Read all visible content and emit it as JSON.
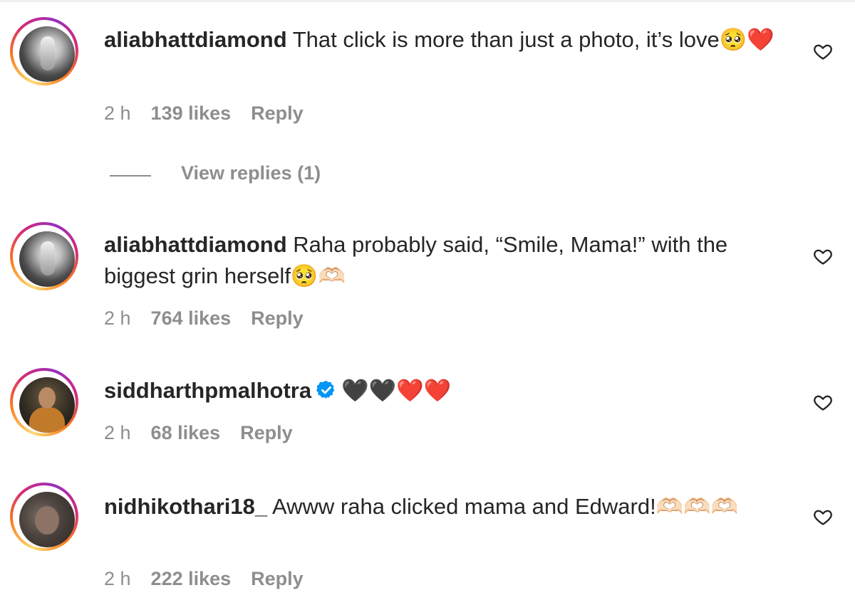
{
  "comments": [
    {
      "username": "aliabhattdiamond",
      "text": " That click is more than just a photo, it’s love🥺❤️",
      "time": "2 h",
      "likes": "139 likes",
      "reply": "Reply",
      "avatar_icon": "profile-photo",
      "like_icon": "heart-outline-icon"
    },
    {
      "username": "aliabhattdiamond",
      "text": " Raha probably said, “Smile, Mama!” with the biggest grin herself🥺🫶🏻",
      "time": "2 h",
      "likes": "764 likes",
      "reply": "Reply",
      "avatar_icon": "profile-photo",
      "like_icon": "heart-outline-icon"
    },
    {
      "username": "siddharthpmalhotra",
      "verified": true,
      "text": "🖤🖤❤️❤️",
      "time": "2 h",
      "likes": "68 likes",
      "reply": "Reply",
      "avatar_icon": "profile-photo",
      "like_icon": "heart-outline-icon"
    },
    {
      "username": "nidhikothari18_",
      "text": " Awww raha clicked mama and Edward!🫶🏻🫶🏻🫶🏻",
      "time": "2 h",
      "likes": "222 likes",
      "reply": "Reply",
      "avatar_icon": "profile-photo",
      "like_icon": "heart-outline-icon"
    }
  ],
  "view_replies": "View replies (1)",
  "colors": {
    "text": "#262626",
    "meta": "#8e8e8e",
    "verified": "#0095f6"
  }
}
